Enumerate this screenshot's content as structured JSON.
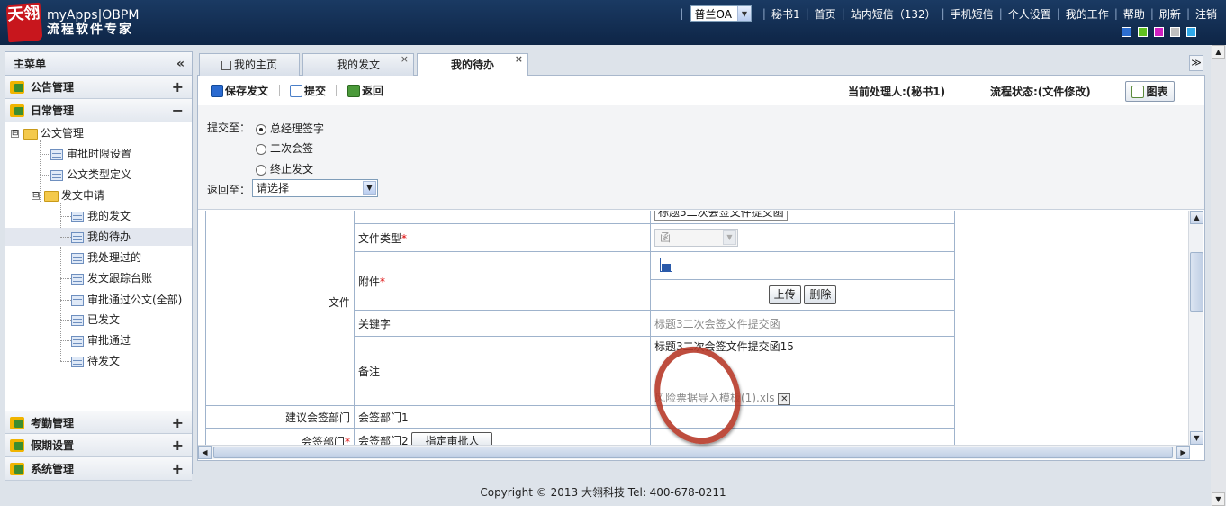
{
  "header": {
    "logo_text": "天翎",
    "brand_title": "myApps|OBPM",
    "brand_subtitle": "流程软件专家",
    "oa_select": "普兰OA",
    "nav": [
      "秘书1",
      "首页",
      "站内短信（132）",
      "手机短信",
      "个人设置",
      "我的工作",
      "帮助",
      "刷新",
      "注销"
    ],
    "theme_colors": [
      "#2d6fd1",
      "#60c020",
      "#d020c0",
      "#c0c0c0",
      "#30a8e8"
    ]
  },
  "sidebar": {
    "title": "主菜单",
    "collapse_icon": "«",
    "modules": [
      {
        "label": "公告管理",
        "toggle": "+"
      },
      {
        "label": "日常管理",
        "toggle": "−"
      },
      {
        "label": "考勤管理",
        "toggle": "+"
      },
      {
        "label": "假期设置",
        "toggle": "+"
      },
      {
        "label": "系统管理",
        "toggle": "+"
      }
    ],
    "tree": {
      "root": "公文管理",
      "items": [
        "审批时限设置",
        "公文类型定义"
      ],
      "sub_folder": "发文申请",
      "sub_items": [
        "我的发文",
        "我的待办",
        "我处理过的",
        "发文跟踪台账",
        "审批通过公文(全部)",
        "已发文",
        "审批通过",
        "待发文"
      ],
      "tree_toggle": "⊟"
    }
  },
  "tabs": [
    {
      "label": "我的主页"
    },
    {
      "label": "我的发文",
      "close": "×"
    },
    {
      "label": "我的待办",
      "close": "×"
    }
  ],
  "tab_more_icon": "≫",
  "toolbar": {
    "save": "保存发文",
    "submit": "提交",
    "back": "返回",
    "current_handler": "当前处理人:(秘书1)",
    "flow_status": "流程状态:(文件修改)",
    "chart": "图表"
  },
  "submit_area": {
    "submit_to_label": "提交至：",
    "options": [
      "总经理签字",
      "二次会签",
      "终止发文"
    ],
    "selected_index": 0,
    "return_to_label": "返回至：",
    "return_select": "请选择"
  },
  "form": {
    "top_field_value": "标题3二次会签文件提交函",
    "group_label": "文件",
    "doc_type_label": "文件类型",
    "doc_type_value": "函",
    "attachment_label": "附件",
    "upload_btn": "上传",
    "delete_btn": "删除",
    "keyword_label": "关键字",
    "keyword_value": "标题3二次会签文件提交函",
    "remark_label": "备注",
    "remark_value": "标题3二次会签文件提交函15",
    "remark_attachment": "风险票据导入模板(1).xls",
    "suggest_dept_label": "建议会签部门",
    "suggest_dept_value": "会签部门1",
    "dept_label": "会签部门",
    "dept_value": "会签部门2",
    "assign_btn": "指定审批人"
  },
  "footer": {
    "copyright": "Copyright © 2013 大翎科技  Tel: 400-678-0211"
  }
}
